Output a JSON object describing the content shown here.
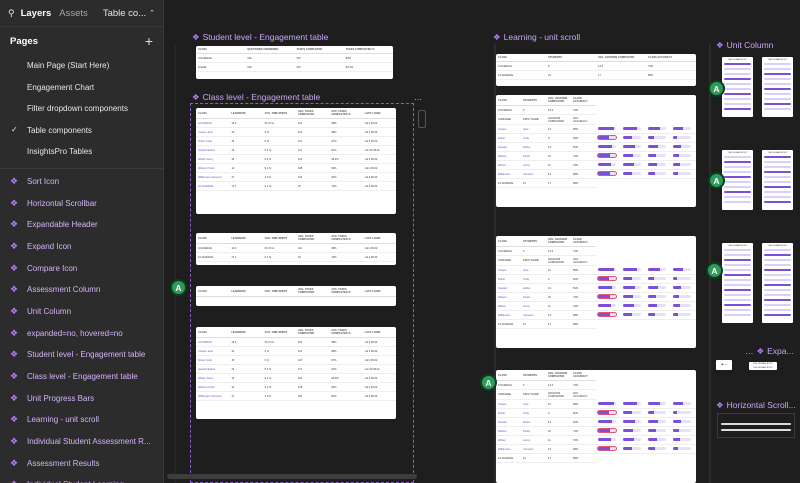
{
  "panel": {
    "tabs": [
      "Layers",
      "Assets"
    ],
    "page_selector": "Table co...",
    "pages_title": "Pages",
    "pages": [
      {
        "label": "Main Page (Start Here)",
        "selected": false
      },
      {
        "label": "Engagement Chart",
        "selected": false
      },
      {
        "label": "Filter dropdown components",
        "selected": false
      },
      {
        "label": "Table components",
        "selected": true
      },
      {
        "label": "InsightsPro Tables",
        "selected": false
      }
    ],
    "layers": [
      "Sort Icon",
      "Horizontal Scrollbar",
      "Expandable Header",
      "Expand Icon",
      "Compare Icon",
      "Assessment Column",
      "Unit Column",
      "expanded=no, hovered=no",
      "Student level - Engagement table",
      "Class level - Engagement table",
      "Unit Progress Bars",
      "Learning - unit scroll",
      "Individual Student Assessment R...",
      "Assessment Results",
      "Individual Student Learning"
    ]
  },
  "canvas": {
    "frames": {
      "student_level": "Student level - Engagement table",
      "class_level": "Class level - Engagement table",
      "learning": "Learning - unit scroll",
      "unit_column": "Unit Column",
      "expa": "Expa...",
      "hscroll": "Horizontal Scroll..."
    },
    "avatar_letter": "A",
    "student_table": {
      "headers": [
        "CLASS",
        "QUESTIONS ANSWERED",
        "TASKS COMPLETED",
        "TASKS COMPLETED %"
      ],
      "rows": [
        [
          "9-SCIENCE",
          "194",
          "327",
          "82%"
        ],
        [
          "8-SCIE",
          "194",
          "327",
          "82.2%"
        ]
      ]
    },
    "class_table": {
      "headers": [
        "CLASS",
        "LEARNERS",
        "AVG. TIME SPENT",
        "AVG. TASKS COMPLETED",
        "AVG. TASKS COMPLETED %",
        "LAST LOGIN"
      ],
      "group": [
        "9-SCIENCE",
        "14.3",
        "3h 0 hrs",
        "121",
        "98%",
        "Jul 2 09:22"
      ],
      "rows": [
        [
          "Cooper",
          "Jane",
          "14",
          "6 hr",
          "121",
          "98%",
          "Jul 1 09:22"
        ],
        [
          "Fisher",
          "Cody",
          "15",
          "6 hr",
          "127",
          "97%",
          "Jul 3 09:22"
        ],
        [
          "Howard",
          "Esther",
          "13",
          "5.4 hr",
          "117",
          "91%",
          "Jun 30 09:22"
        ],
        [
          "Wilson",
          "Jenny",
          "15",
          "6.4 hr",
          "123",
          "96.2%",
          "Jul 2 09:22"
        ],
        [
          "Watson",
          "Kristin",
          "14",
          "5.2 hr",
          "108",
          "90%",
          "Jul 2 09:22"
        ],
        [
          "Williamson",
          "Cameron",
          "17",
          "4.9 hr",
          "119",
          "92%",
          "Jul 3 09:22"
        ]
      ],
      "footer": [
        "10-SCIENCE",
        "17.1",
        "6.1 hr",
        "97",
        "73%",
        "Jul 2 09:22"
      ]
    },
    "learning_table": {
      "headers": [
        "CLASS",
        "STUDENTS",
        "AVG. LESSONS COMPLETED",
        "CLASS ACCURACY"
      ],
      "groups": [
        [
          "9-SCIENCE",
          "6",
          "14.3",
          "73%"
        ],
        [
          "10-SCIENCE",
          "21",
          "17",
          "68%"
        ]
      ],
      "student_headers": [
        "SURNAME",
        "FIRST NAME",
        "LESSONS COMPLETED",
        "AVG. ACCURACY",
        "THE HUMAN BODY",
        "CELLS",
        "ORGANISMS",
        "QUESTIONS"
      ],
      "students": [
        [
          "Cooper",
          "Jane",
          "12",
          "85%"
        ],
        [
          "Fisher",
          "Cody",
          "9",
          "60%"
        ],
        [
          "Howard",
          "Esther",
          "13",
          "81%"
        ],
        [
          "Watson",
          "Kristin",
          "10",
          "73%"
        ],
        [
          "Wilson",
          "Jenny",
          "11",
          "79%"
        ],
        [
          "Williamson",
          "Cameron",
          "13",
          "68%"
        ]
      ],
      "progress": [
        0.9,
        0.6,
        0.8,
        0.7,
        0.75,
        0.65
      ]
    },
    "unit_titles": [
      "THE HUMAN BODY",
      "THE HUMAN BODY"
    ]
  }
}
